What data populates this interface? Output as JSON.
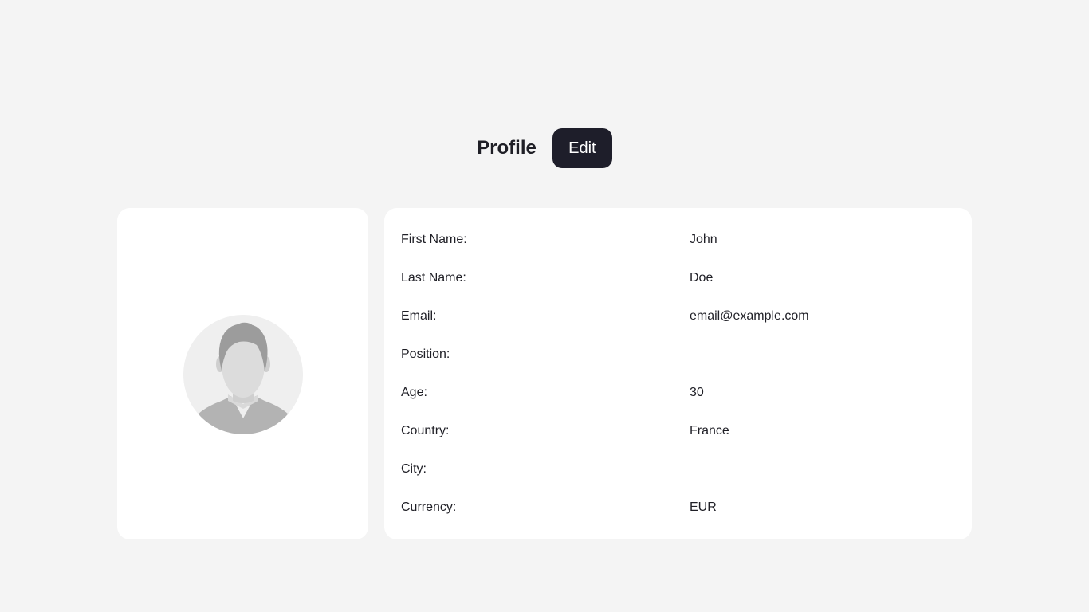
{
  "header": {
    "title": "Profile",
    "edit_label": "Edit"
  },
  "avatar": {
    "icon": "default-user-avatar-icon"
  },
  "details": [
    {
      "label": "First Name:",
      "value": "John"
    },
    {
      "label": "Last Name:",
      "value": "Doe"
    },
    {
      "label": "Email:",
      "value": "email@example.com"
    },
    {
      "label": "Position:",
      "value": ""
    },
    {
      "label": "Age:",
      "value": "30"
    },
    {
      "label": "Country:",
      "value": "France"
    },
    {
      "label": "City:",
      "value": ""
    },
    {
      "label": "Currency:",
      "value": "EUR"
    }
  ],
  "colors": {
    "background": "#f4f4f4",
    "card": "#ffffff",
    "button": "#1e1e2a",
    "text": "#1f1f26"
  }
}
